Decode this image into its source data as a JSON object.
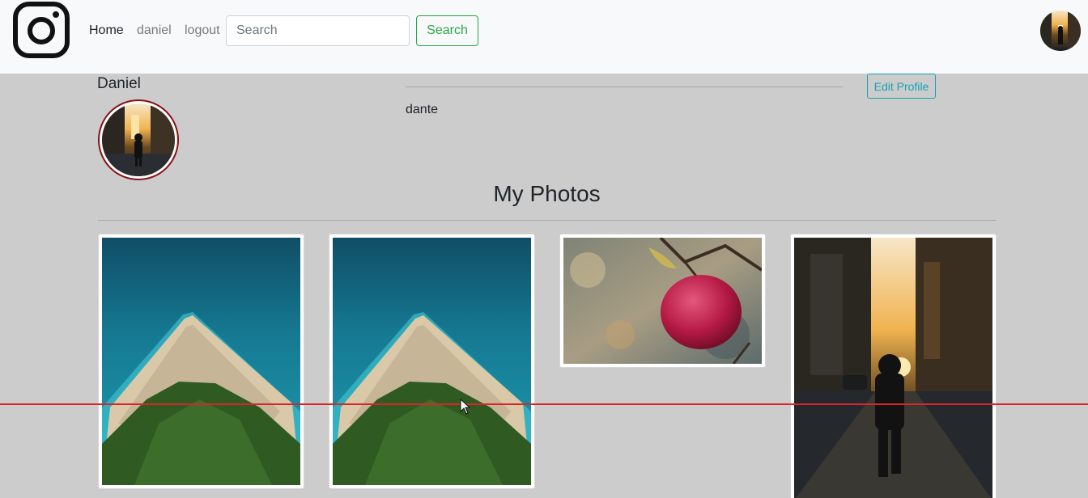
{
  "navbar": {
    "links": [
      {
        "label": "Home",
        "active": true
      },
      {
        "label": "daniel",
        "active": false
      },
      {
        "label": "logout",
        "active": false
      }
    ],
    "search": {
      "placeholder": "Search",
      "value": ""
    },
    "search_button": "Search",
    "logo_icon": "instagram-logo-icon"
  },
  "profile": {
    "name": "Daniel",
    "bio": "dante",
    "edit_button": "Edit Profile"
  },
  "photos_section": {
    "title": "My Photos",
    "photos": [
      {
        "subject": "aerial beach"
      },
      {
        "subject": "aerial beach"
      },
      {
        "subject": "red apple on branch"
      },
      {
        "subject": "person walking city street"
      }
    ]
  },
  "colors": {
    "navbar_bg": "#f8f9fa",
    "page_bg": "#cccccc",
    "search_accent": "#28a745",
    "edit_accent": "#17a2b8",
    "avatar_ring": "#8b0f14",
    "guide_line": "#d8262a"
  }
}
